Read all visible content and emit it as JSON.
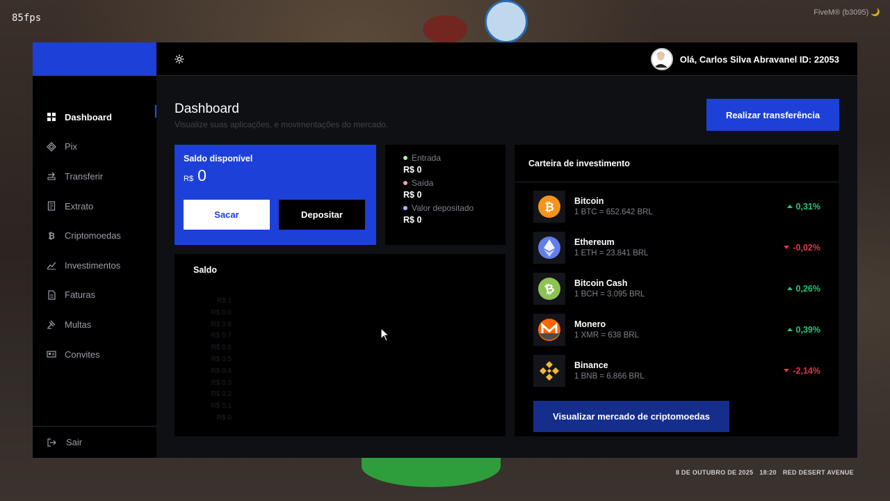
{
  "overlay": {
    "fps": "85fps",
    "fivem": "FiveM® (b3095) 🌙",
    "hud": {
      "date": "8 DE OUTUBRO DE 2025",
      "time": "18:20",
      "street": "RED DESERT AVENUE"
    }
  },
  "sidebar": {
    "items": [
      {
        "label": "Dashboard",
        "icon": "grid-icon"
      },
      {
        "label": "Pix",
        "icon": "pix-icon"
      },
      {
        "label": "Transferir",
        "icon": "transfer-icon"
      },
      {
        "label": "Extrato",
        "icon": "statement-icon"
      },
      {
        "label": "Criptomoedas",
        "icon": "bitcoin-icon"
      },
      {
        "label": "Investimentos",
        "icon": "chart-line-icon"
      },
      {
        "label": "Faturas",
        "icon": "invoice-icon"
      },
      {
        "label": "Multas",
        "icon": "gavel-icon"
      },
      {
        "label": "Convites",
        "icon": "card-icon"
      }
    ],
    "logout_label": "Sair"
  },
  "topbar": {
    "user_text": "Olá, Carlos Silva Abravanel ID: 22053"
  },
  "page": {
    "title": "Dashboard",
    "subtitle": "Visualize suas aplicações, e movimentações do mercado.",
    "transfer_button": "Realizar transferência"
  },
  "balance": {
    "title": "Saldo disponível",
    "currency": "R$",
    "value": "0",
    "withdraw_button": "Sacar",
    "deposit_button": "Depositar"
  },
  "flow": {
    "entrada_label": "Entrada",
    "entrada_value": "R$ 0",
    "saida_label": "Saída",
    "saida_value": "R$ 0",
    "deposito_label": "Valor depositado",
    "deposito_value": "R$ 0",
    "colors": {
      "entrada": "#a8f0a0",
      "saida": "#f4a0b0",
      "deposito": "#b0b8f8"
    }
  },
  "saldo_chart": {
    "title": "Saldo",
    "ticks": [
      "R$ 1",
      "R$ 0.9",
      "R$ 0.8",
      "R$ 0.7",
      "R$ 0.6",
      "R$ 0.5",
      "R$ 0.4",
      "R$ 0.3",
      "R$ 0.2",
      "R$ 0.1",
      "R$ 0"
    ]
  },
  "wallet": {
    "title": "Carteira de investimento",
    "coins": [
      {
        "name": "Bitcoin",
        "rate": "1 BTC = 652.642 BRL",
        "change": "0,31%",
        "direction": "up"
      },
      {
        "name": "Ethereum",
        "rate": "1 ETH = 23.841 BRL",
        "change": "-0,02%",
        "direction": "down"
      },
      {
        "name": "Bitcoin Cash",
        "rate": "1 BCH = 3.095 BRL",
        "change": "0,26%",
        "direction": "up"
      },
      {
        "name": "Monero",
        "rate": "1 XMR = 638 BRL",
        "change": "0,39%",
        "direction": "up"
      },
      {
        "name": "Binance",
        "rate": "1 BNB = 6.866 BRL",
        "change": "-2,14%",
        "direction": "down"
      }
    ],
    "market_button": "Visualizar mercado de criptomoedas"
  },
  "colors": {
    "accent": "#1d40d8",
    "up": "#1fc77a",
    "down": "#e6324b"
  }
}
